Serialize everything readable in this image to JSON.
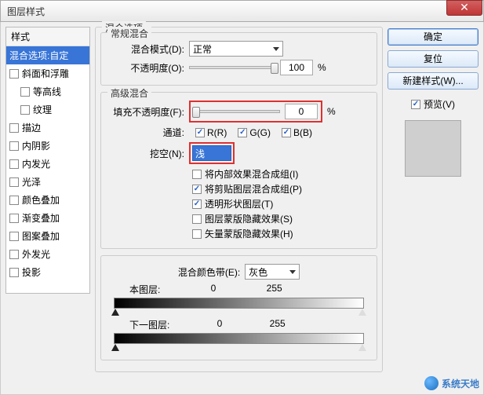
{
  "window": {
    "title": "图层样式"
  },
  "styles": {
    "header": "样式",
    "selected": "混合选项:自定",
    "items": [
      {
        "label": "斜面和浮雕",
        "indent": false
      },
      {
        "label": "等高线",
        "indent": true
      },
      {
        "label": "纹理",
        "indent": true
      },
      {
        "label": "描边",
        "indent": false
      },
      {
        "label": "内阴影",
        "indent": false
      },
      {
        "label": "内发光",
        "indent": false
      },
      {
        "label": "光泽",
        "indent": false
      },
      {
        "label": "颜色叠加",
        "indent": false
      },
      {
        "label": "渐变叠加",
        "indent": false
      },
      {
        "label": "图案叠加",
        "indent": false
      },
      {
        "label": "外发光",
        "indent": false
      },
      {
        "label": "投影",
        "indent": false
      }
    ]
  },
  "blend_options": {
    "section": "混合选项",
    "general": {
      "title": "常规混合",
      "mode_label": "混合模式(D):",
      "mode_value": "正常",
      "opacity_label": "不透明度(O):",
      "opacity_value": "100",
      "pct": "%"
    },
    "advanced": {
      "title": "高级混合",
      "fill_label": "填充不透明度(F):",
      "fill_value": "0",
      "pct": "%",
      "channel_label": "通道:",
      "channels": {
        "r": "R(R)",
        "g": "G(G)",
        "b": "B(B)"
      },
      "knockout_label": "挖空(N):",
      "knockout_value": "浅",
      "checks": [
        {
          "label": "将内部效果混合成组(I)",
          "checked": false
        },
        {
          "label": "将剪贴图层混合成组(P)",
          "checked": true
        },
        {
          "label": "透明形状图层(T)",
          "checked": true
        },
        {
          "label": "图层蒙版隐藏效果(S)",
          "checked": false
        },
        {
          "label": "矢量蒙版隐藏效果(H)",
          "checked": false
        }
      ]
    },
    "blendif": {
      "label": "混合颜色带(E):",
      "value": "灰色",
      "this_layer": "本图层:",
      "under_layer": "下一图层:",
      "v0": "0",
      "v255": "255"
    }
  },
  "buttons": {
    "ok": "确定",
    "cancel": "复位",
    "newstyle": "新建样式(W)...",
    "preview": "预览(V)"
  },
  "watermark": "系统天地"
}
